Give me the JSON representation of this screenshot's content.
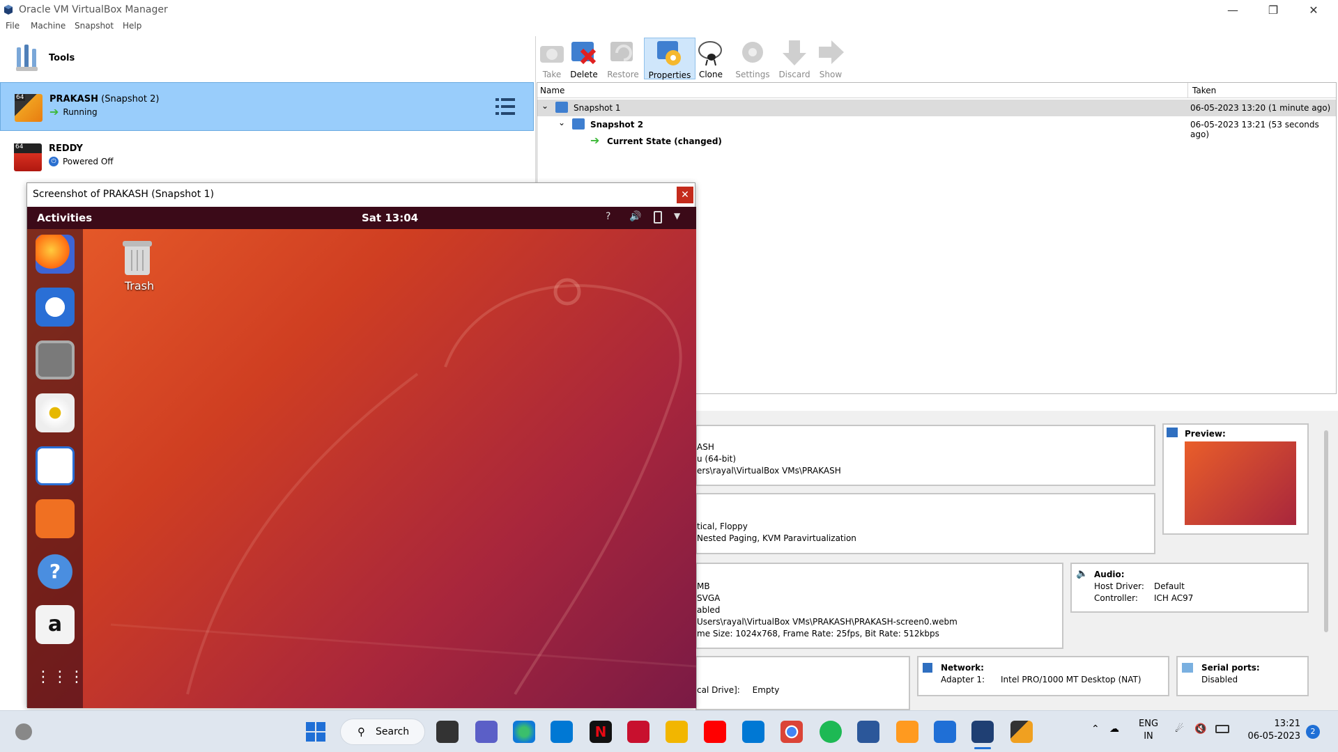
{
  "window": {
    "title": "Oracle VM VirtualBox Manager"
  },
  "menu": [
    "File",
    "Machine",
    "Snapshot",
    "Help"
  ],
  "tools_label": "Tools",
  "vms": [
    {
      "name": "PRAKASH",
      "snapshot": "(Snapshot 2)",
      "state": "Running",
      "badge": "64"
    },
    {
      "name": "REDDY",
      "snapshot": "",
      "state": "Powered Off",
      "badge": "64"
    }
  ],
  "toolbar": [
    {
      "label": "Take",
      "enabled": false
    },
    {
      "label": "Delete",
      "enabled": true
    },
    {
      "label": "Restore",
      "enabled": false
    },
    {
      "label": "Properties",
      "enabled": true,
      "active": true
    },
    {
      "label": "Clone",
      "enabled": true
    },
    {
      "label": "Settings",
      "enabled": false
    },
    {
      "label": "Discard",
      "enabled": false
    },
    {
      "label": "Show",
      "enabled": false
    }
  ],
  "snapshots": {
    "col_name": "Name",
    "col_taken": "Taken",
    "rows": [
      {
        "name": "Snapshot 1",
        "taken": "06-05-2023 13:20 (1 minute ago)"
      },
      {
        "name": "Snapshot 2",
        "taken": "06-05-2023 13:21 (53 seconds ago)"
      },
      {
        "name": "Current State (changed)",
        "taken": ""
      }
    ]
  },
  "details": {
    "general_lines": [
      "ASH",
      "u (64-bit)",
      "ers\\rayal\\VirtualBox VMs\\PRAKASH"
    ],
    "system_lines": [
      "tical, Floppy",
      " Nested Paging, KVM Paravirtualization"
    ],
    "display_lines": [
      "MB",
      "SVGA",
      "abled",
      "Users\\rayal\\VirtualBox VMs\\PRAKASH\\PRAKASH-screen0.webm",
      "me Size: 1024x768, Frame Rate: 25fps, Bit Rate: 512kbps"
    ],
    "storage_line_label": "cal Drive]:",
    "storage_line_value": "Empty",
    "preview_title": "Preview:",
    "audio_title": "Audio:",
    "audio_host_label": "Host Driver:",
    "audio_host_value": "Default",
    "audio_ctrl_label": "Controller:",
    "audio_ctrl_value": "ICH AC97",
    "network_title": "Network:",
    "network_label": "Adapter 1:",
    "network_value": "Intel PRO/1000 MT Desktop (NAT)",
    "serial_title": "Serial ports:",
    "serial_value": "Disabled"
  },
  "screenshot_window": {
    "title": "Screenshot of PRAKASH (Snapshot 1)",
    "activities": "Activities",
    "clock": "Sat 13:04",
    "trash_label": "Trash"
  },
  "taskbar": {
    "search": "Search",
    "lang1": "ENG",
    "lang2": "IN",
    "time": "13:21",
    "date": "06-05-2023",
    "notif_count": "2"
  },
  "colors": {
    "selection": "#99cdfb",
    "ubuntu_orange": "#e95e2a",
    "ubuntu_bar": "#3b0a18"
  }
}
